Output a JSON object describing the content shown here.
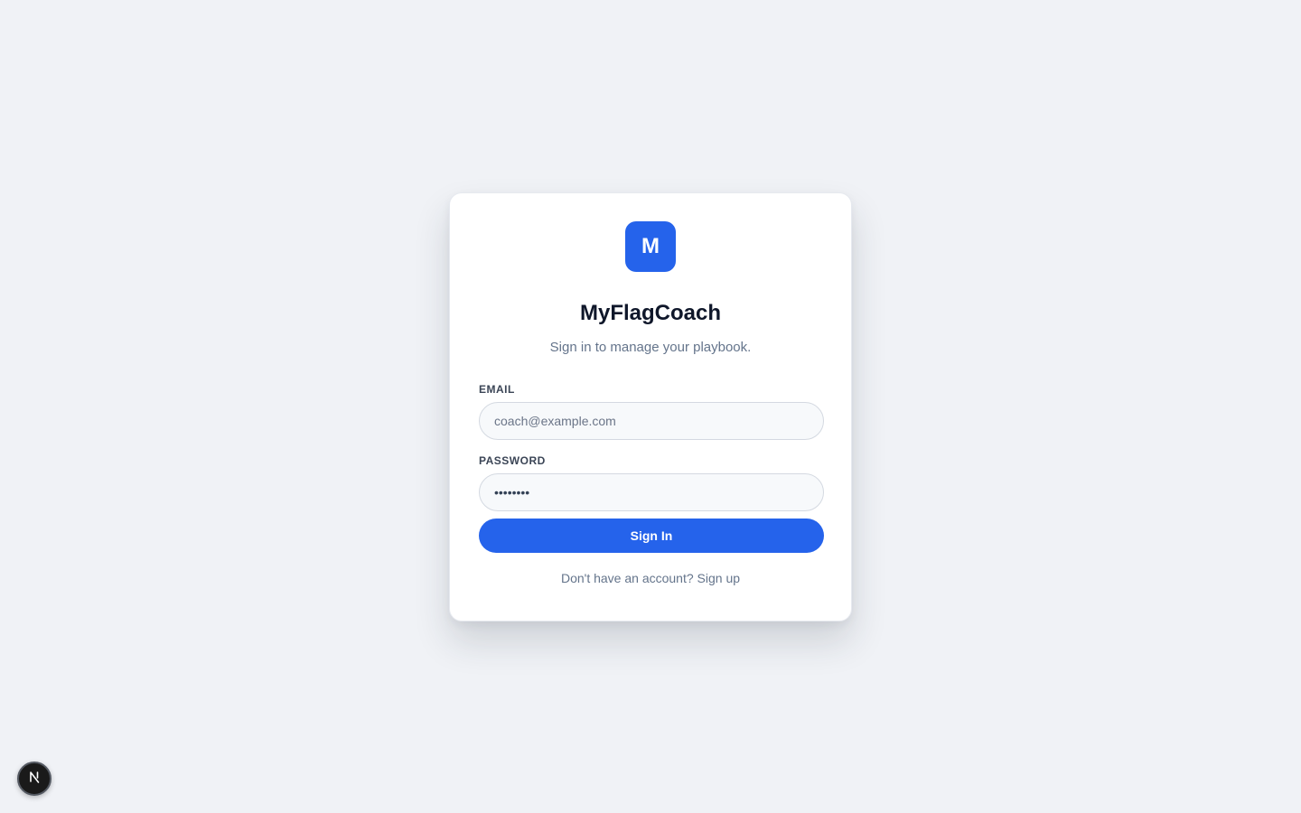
{
  "brand": {
    "logo_letter": "M",
    "title": "MyFlagCoach",
    "subtitle": "Sign in to manage your playbook.",
    "accent_color": "#2563eb"
  },
  "form": {
    "email": {
      "label": "EMAIL",
      "value": "",
      "placeholder": "coach@example.com"
    },
    "password": {
      "label": "PASSWORD",
      "value": "••••••••",
      "placeholder": "••••••••"
    },
    "submit_label": "Sign In"
  },
  "footer": {
    "prompt": "Don't have an account?",
    "signup_label": "Sign up"
  },
  "dev_badge": {
    "icon": "nextjs-icon"
  }
}
